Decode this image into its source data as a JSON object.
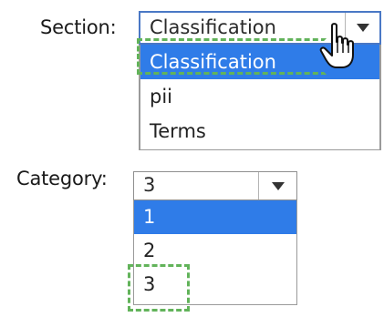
{
  "section": {
    "label": "Section:",
    "selected_value": "Classification",
    "options": [
      "Classification",
      "pii",
      "Terms"
    ],
    "highlighted_option": "Classification"
  },
  "category": {
    "label": "Category:",
    "selected_value": "3",
    "options": [
      "1",
      "2",
      "3"
    ],
    "highlighted_option": "1"
  },
  "icons": {
    "dropdown_arrow": "chevron-down-icon",
    "pointer": "hand-pointer-icon"
  },
  "colors": {
    "selection_highlight": "#2f7ce8",
    "focus_border": "#4a78c5",
    "annotation_dashes": "#62b35a"
  }
}
